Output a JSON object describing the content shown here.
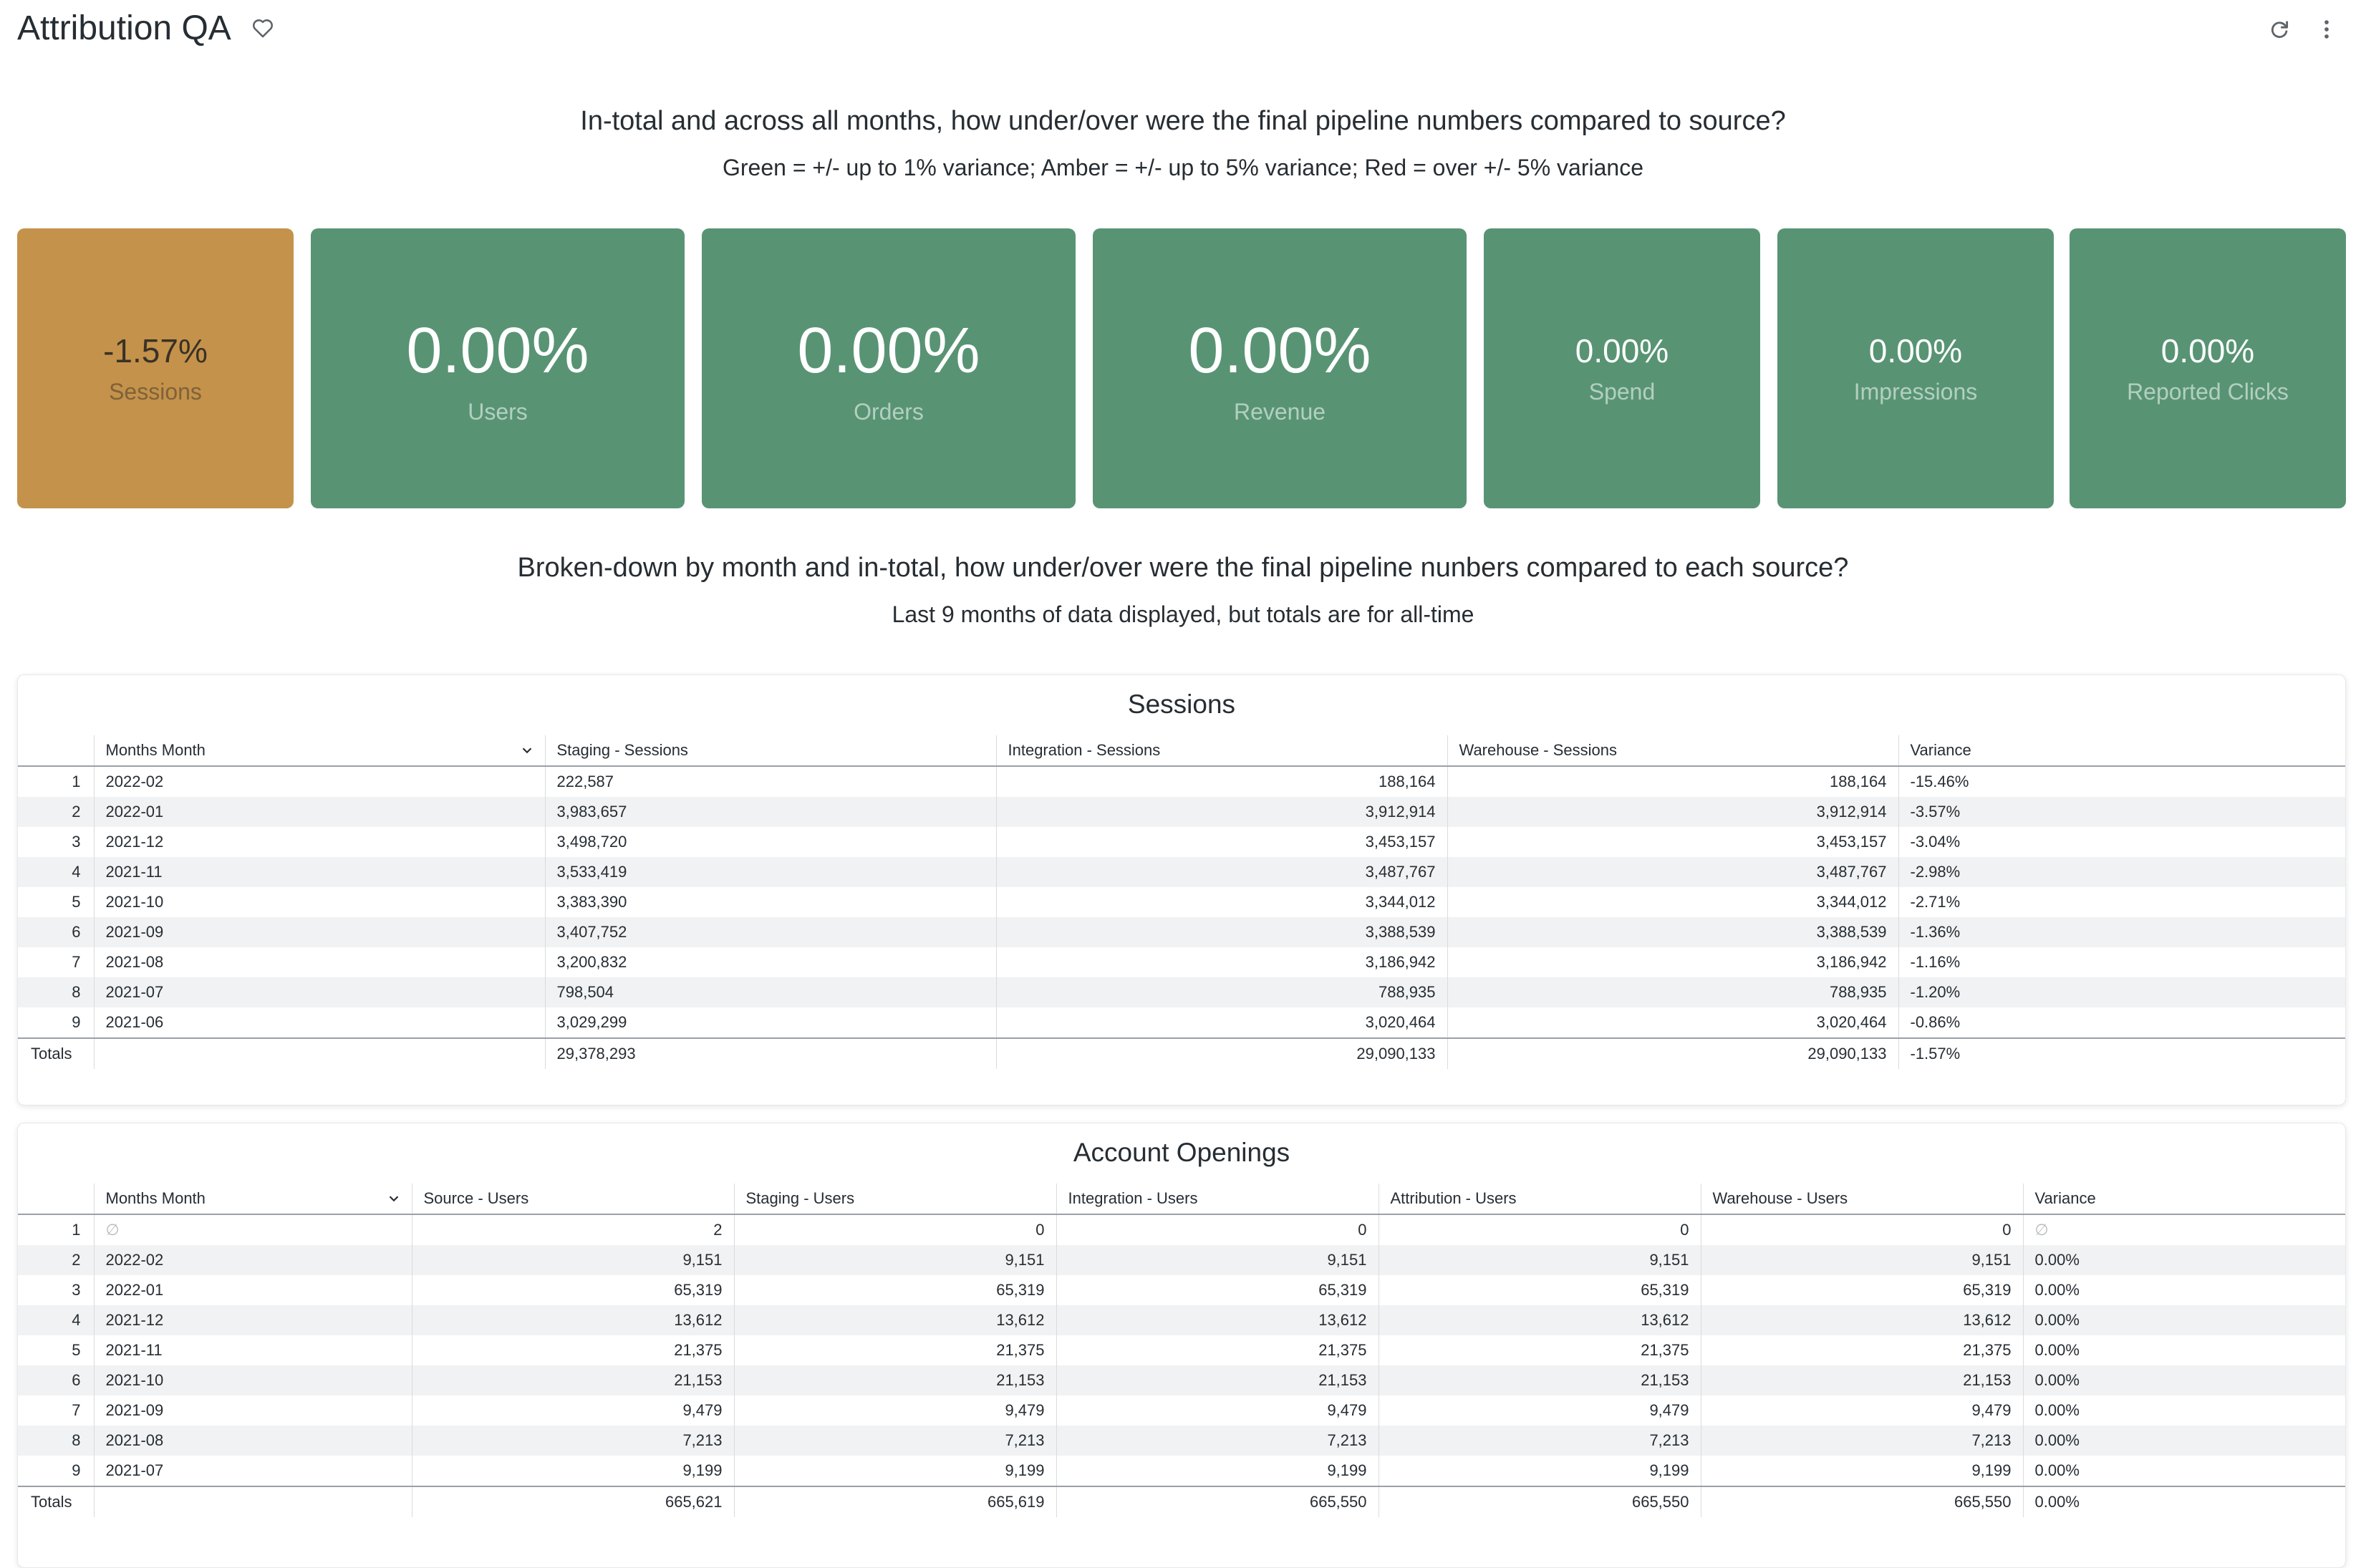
{
  "header": {
    "title": "Attribution QA"
  },
  "summary": {
    "question": "In-total and across all months, how under/over were the final pipeline numbers compared to source?",
    "legend": "Green = +/- up to 1% variance; Amber = +/- up to 5% variance; Red = over +/- 5% variance",
    "tiles": [
      {
        "value": "-1.57%",
        "label": "Sessions",
        "status": "amber",
        "color": "#c4924a"
      },
      {
        "value": "0.00%",
        "label": "Users",
        "status": "green",
        "color": "#589474"
      },
      {
        "value": "0.00%",
        "label": "Orders",
        "status": "green",
        "color": "#589474"
      },
      {
        "value": "0.00%",
        "label": "Revenue",
        "status": "green",
        "color": "#589474"
      },
      {
        "value": "0.00%",
        "label": "Spend",
        "status": "green",
        "color": "#589474"
      },
      {
        "value": "0.00%",
        "label": "Impressions",
        "status": "green",
        "color": "#589474"
      },
      {
        "value": "0.00%",
        "label": "Reported Clicks",
        "status": "green",
        "color": "#589474"
      }
    ]
  },
  "breakdown": {
    "question": "Broken-down by month and in-total, how under/over were the final pipeline nunbers compared to each source?",
    "note": "Last 9 months of data displayed, but totals are for all-time"
  },
  "sessions_table": {
    "title": "Sessions",
    "columns": [
      "",
      "Months Month",
      "Staging - Sessions",
      "Integration - Sessions",
      "Warehouse - Sessions",
      "Variance"
    ],
    "rows": [
      [
        "1",
        "2022-02",
        "222,587",
        "188,164",
        "188,164",
        "-15.46%"
      ],
      [
        "2",
        "2022-01",
        "3,983,657",
        "3,912,914",
        "3,912,914",
        "-3.57%"
      ],
      [
        "3",
        "2021-12",
        "3,498,720",
        "3,453,157",
        "3,453,157",
        "-3.04%"
      ],
      [
        "4",
        "2021-11",
        "3,533,419",
        "3,487,767",
        "3,487,767",
        "-2.98%"
      ],
      [
        "5",
        "2021-10",
        "3,383,390",
        "3,344,012",
        "3,344,012",
        "-2.71%"
      ],
      [
        "6",
        "2021-09",
        "3,407,752",
        "3,388,539",
        "3,388,539",
        "-1.36%"
      ],
      [
        "7",
        "2021-08",
        "3,200,832",
        "3,186,942",
        "3,186,942",
        "-1.16%"
      ],
      [
        "8",
        "2021-07",
        "798,504",
        "788,935",
        "788,935",
        "-1.20%"
      ],
      [
        "9",
        "2021-06",
        "3,029,299",
        "3,020,464",
        "3,020,464",
        "-0.86%"
      ]
    ],
    "totals": [
      "Totals",
      "",
      "29,378,293",
      "29,090,133",
      "29,090,133",
      "-1.57%"
    ]
  },
  "accounts_table": {
    "title": "Account Openings",
    "columns": [
      "",
      "Months Month",
      "Source - Users",
      "Staging - Users",
      "Integration - Users",
      "Attribution - Users",
      "Warehouse - Users",
      "Variance"
    ],
    "rows": [
      [
        "1",
        "∅",
        "2",
        "0",
        "0",
        "0",
        "0",
        "∅"
      ],
      [
        "2",
        "2022-02",
        "9,151",
        "9,151",
        "9,151",
        "9,151",
        "9,151",
        "0.00%"
      ],
      [
        "3",
        "2022-01",
        "65,319",
        "65,319",
        "65,319",
        "65,319",
        "65,319",
        "0.00%"
      ],
      [
        "4",
        "2021-12",
        "13,612",
        "13,612",
        "13,612",
        "13,612",
        "13,612",
        "0.00%"
      ],
      [
        "5",
        "2021-11",
        "21,375",
        "21,375",
        "21,375",
        "21,375",
        "21,375",
        "0.00%"
      ],
      [
        "6",
        "2021-10",
        "21,153",
        "21,153",
        "21,153",
        "21,153",
        "21,153",
        "0.00%"
      ],
      [
        "7",
        "2021-09",
        "9,479",
        "9,479",
        "9,479",
        "9,479",
        "9,479",
        "0.00%"
      ],
      [
        "8",
        "2021-08",
        "7,213",
        "7,213",
        "7,213",
        "7,213",
        "7,213",
        "0.00%"
      ],
      [
        "9",
        "2021-07",
        "9,199",
        "9,199",
        "9,199",
        "9,199",
        "9,199",
        "0.00%"
      ]
    ],
    "totals": [
      "Totals",
      "",
      "665,621",
      "665,619",
      "665,550",
      "665,550",
      "665,550",
      "0.00%"
    ]
  },
  "icons": {
    "favorite": "heart-outline-icon",
    "reload": "refresh-icon",
    "menu": "more-vert-icon",
    "sort": "chevron-down-icon"
  }
}
